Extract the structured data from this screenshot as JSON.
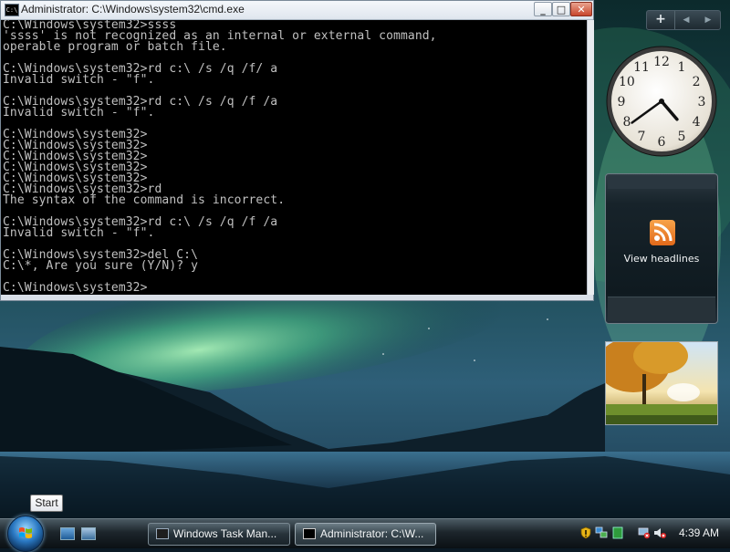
{
  "cmd": {
    "title": "Administrator: C:\\Windows\\system32\\cmd.exe",
    "icon_text": "C:\\",
    "min_label": "_",
    "max_label": "□",
    "close_label": "✕",
    "lines": [
      "C:\\Windows\\system32>ssss",
      "'ssss' is not recognized as an internal or external command,",
      "operable program or batch file.",
      "",
      "C:\\Windows\\system32>rd c:\\ /s /q /f/ a",
      "Invalid switch - \"f\".",
      "",
      "C:\\Windows\\system32>rd c:\\ /s /q /f /a",
      "Invalid switch - \"f\".",
      "",
      "C:\\Windows\\system32>",
      "C:\\Windows\\system32>",
      "C:\\Windows\\system32>",
      "C:\\Windows\\system32>",
      "C:\\Windows\\system32>",
      "C:\\Windows\\system32>rd",
      "The syntax of the command is incorrect.",
      "",
      "C:\\Windows\\system32>rd c:\\ /s /q /f /a",
      "Invalid switch - \"f\".",
      "",
      "C:\\Windows\\system32>del C:\\",
      "C:\\*, Are you sure (Y/N)? y",
      "",
      "C:\\Windows\\system32>"
    ]
  },
  "sidebar": {
    "add_label": "+",
    "prev_label": "◀",
    "next_label": "▶"
  },
  "clock": {
    "numbers": [
      "12",
      "1",
      "2",
      "3",
      "4",
      "5",
      "6",
      "7",
      "8",
      "9",
      "10",
      "11"
    ],
    "hour": 4,
    "minute": 39
  },
  "feed": {
    "label": "View headlines"
  },
  "start": {
    "tooltip": "Start"
  },
  "taskbar": {
    "buttons": [
      {
        "label": "Windows Task Man..."
      },
      {
        "label": "Administrator: C:\\W..."
      }
    ],
    "time": "4:39 AM"
  },
  "colors": {
    "console_bg": "#000000",
    "console_text": "#c0c0c0",
    "rss_orange": "#e1691a",
    "taskbar_dark": "#1c252b"
  }
}
